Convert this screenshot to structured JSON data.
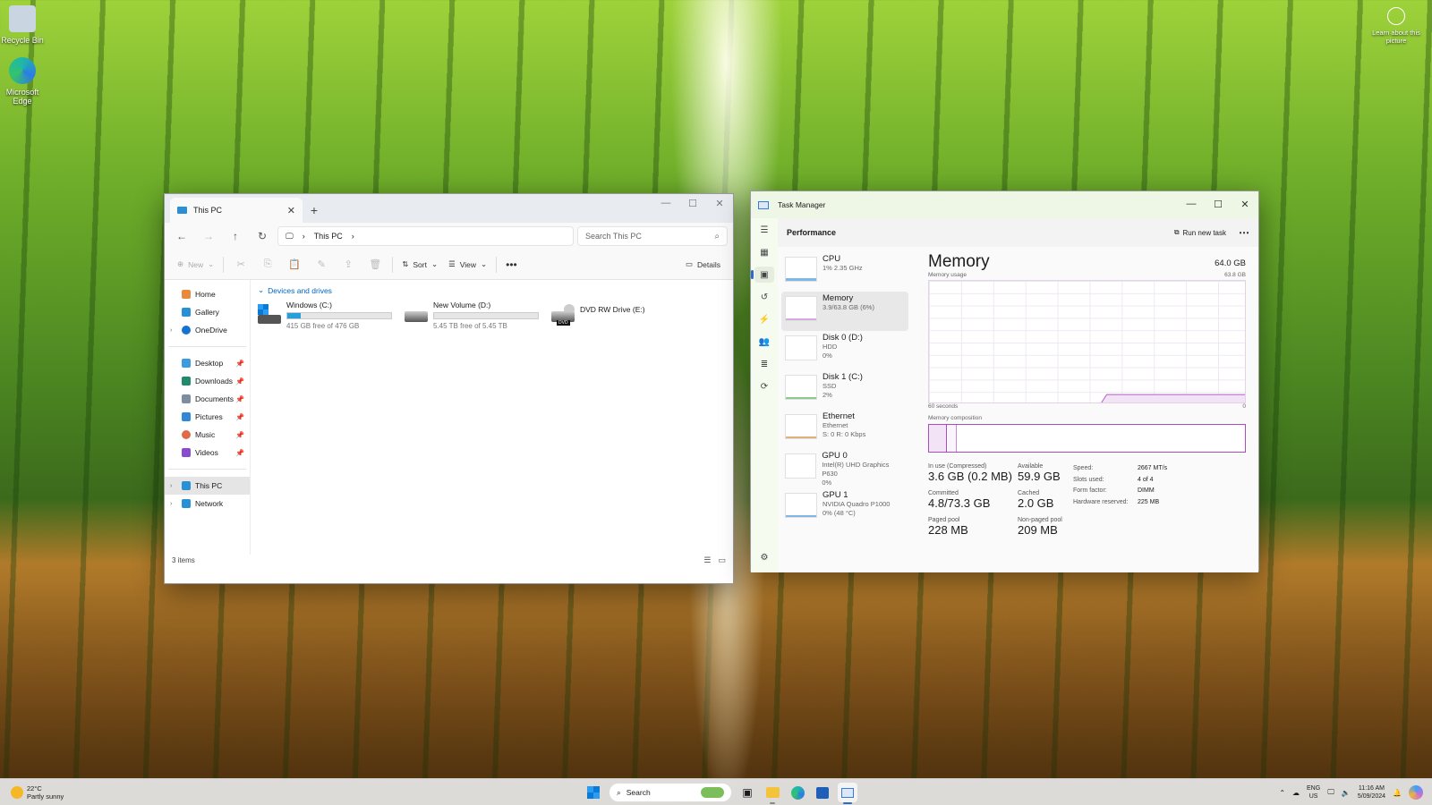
{
  "desktop": {
    "icons": [
      {
        "label": "Recycle Bin"
      },
      {
        "label": "Microsoft Edge"
      }
    ],
    "learn_label": "Learn about this picture"
  },
  "explorer": {
    "tab_title": "This PC",
    "address": "This PC",
    "search_placeholder": "Search This PC",
    "commands": {
      "new": "New",
      "sort": "Sort",
      "view": "View",
      "details": "Details"
    },
    "nav": {
      "top": [
        "Home",
        "Gallery",
        "OneDrive"
      ],
      "pinned": [
        "Desktop",
        "Downloads",
        "Documents",
        "Pictures",
        "Music",
        "Videos"
      ],
      "bottom": [
        "This PC",
        "Network"
      ]
    },
    "group_label": "Devices and drives",
    "drives": [
      {
        "name": "Windows (C:)",
        "free": "415 GB free of 476 GB",
        "used_fraction": 0.13
      },
      {
        "name": "New Volume (D:)",
        "free": "5.45 TB free of 5.45 TB",
        "used_fraction": 0.0
      },
      {
        "name": "DVD RW Drive (E:)",
        "badge": "DVD"
      }
    ],
    "status": "3 items"
  },
  "taskmanager": {
    "title": "Task Manager",
    "section": "Performance",
    "run_new_task": "Run new task",
    "perf_items": [
      {
        "name": "CPU",
        "sub1": "1% 2.35 GHz",
        "sub2": ""
      },
      {
        "name": "Memory",
        "sub1": "3.9/63.8 GB (6%)",
        "sub2": ""
      },
      {
        "name": "Disk 0 (D:)",
        "sub1": "HDD",
        "sub2": "0%"
      },
      {
        "name": "Disk 1 (C:)",
        "sub1": "SSD",
        "sub2": "2%"
      },
      {
        "name": "Ethernet",
        "sub1": "Ethernet",
        "sub2": "S: 0 R: 0 Kbps"
      },
      {
        "name": "GPU 0",
        "sub1": "Intel(R) UHD Graphics P630",
        "sub2": "0%"
      },
      {
        "name": "GPU 1",
        "sub1": "NVIDIA Quadro P1000",
        "sub2": "0% (48 °C)"
      }
    ],
    "memory": {
      "title": "Memory",
      "capacity": "64.0 GB",
      "usage_label": "Memory usage",
      "usage_max": "63.8 GB",
      "axis_left": "60 seconds",
      "axis_right": "0",
      "composition_label": "Memory composition",
      "in_use_label": "In use (Compressed)",
      "in_use": "3.6 GB (0.2 MB)",
      "available_label": "Available",
      "available": "59.9 GB",
      "committed_label": "Committed",
      "committed": "4.8/73.3 GB",
      "cached_label": "Cached",
      "cached": "2.0 GB",
      "paged_label": "Paged pool",
      "paged": "228 MB",
      "nonpaged_label": "Non-paged pool",
      "nonpaged": "209 MB",
      "kv": [
        {
          "k": "Speed:",
          "v": "2667 MT/s"
        },
        {
          "k": "Slots used:",
          "v": "4 of 4"
        },
        {
          "k": "Form factor:",
          "v": "DIMM"
        },
        {
          "k": "Hardware reserved:",
          "v": "225 MB"
        }
      ]
    }
  },
  "taskbar": {
    "temp": "22°C",
    "weather": "Partly sunny",
    "search": "Search",
    "lang1": "ENG",
    "lang2": "US",
    "time": "11:16 AM",
    "date": "5/09/2024"
  }
}
